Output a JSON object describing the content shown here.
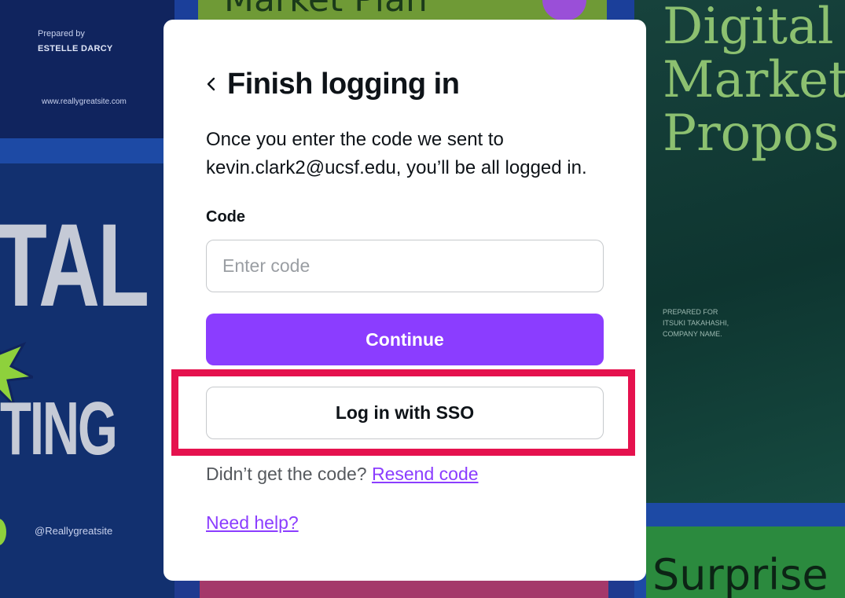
{
  "background": {
    "left_poster": {
      "prepared_by": "Prepared by",
      "author": "ESTELLE DARCY",
      "website": "www.reallygreatsite.com",
      "headline_line1": "TAL",
      "headline_line2": "TING",
      "handle": "@Reallygreatsite"
    },
    "top_poster": {
      "title": "Market Plan"
    },
    "right_poster": {
      "title_lines": [
        "Digital",
        "Market",
        "Propos"
      ],
      "prepared_for": [
        "PREPARED FOR",
        "ITSUKI TAKAHASHI,",
        "COMPANY NAME."
      ]
    },
    "bottom_right_poster": {
      "title": "Surprise"
    }
  },
  "modal": {
    "title": "Finish logging in",
    "description": "Once you enter the code we sent to kevin.clark2@ucsf.edu, you’ll be all logged in.",
    "code_label": "Code",
    "code_placeholder": "Enter code",
    "code_value": "",
    "continue_label": "Continue",
    "sso_label": "Log in with SSO",
    "resend_prompt": "Didn’t get the code?",
    "resend_link": "Resend code",
    "help_link": "Need help?"
  },
  "icons": {
    "back": "chevron-left-icon"
  },
  "colors": {
    "accent": "#8b3dff",
    "highlight": "#e5124e",
    "text": "#0e1318",
    "muted_text": "#55595e"
  }
}
